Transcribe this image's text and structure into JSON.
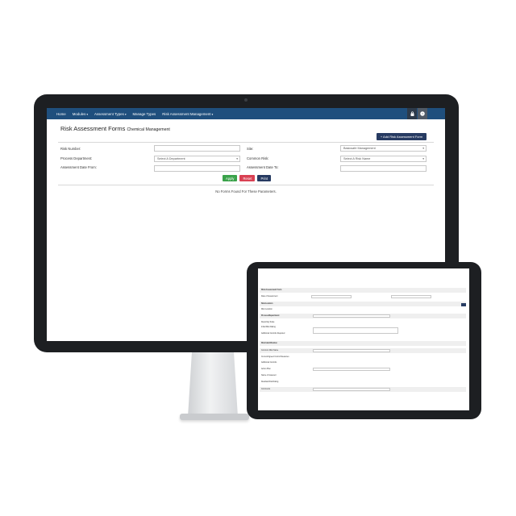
{
  "nav": {
    "items": [
      {
        "label": "Home",
        "dropdown": false
      },
      {
        "label": "Modules",
        "dropdown": true
      },
      {
        "label": "Assessment Types",
        "dropdown": true
      },
      {
        "label": "Manage Types",
        "dropdown": false
      },
      {
        "label": "Risk Assessment Management",
        "dropdown": true
      }
    ],
    "caret": "▾",
    "lock_icon": "lock-icon",
    "help_icon": "help-icon"
  },
  "page": {
    "title": "Risk Assessment Forms",
    "subtitle": "Chemical Management",
    "add_button": "+ Add Risk Assessment Form"
  },
  "filters": {
    "risk_number_label": "Risk Number:",
    "site_label": "Site:",
    "site_value": "Basicsafe Management",
    "process_department_label": "Process Department:",
    "department_placeholder": "Select A Department",
    "common_risk_label": "Common Risk:",
    "risk_name_placeholder": "Select A Risk Name",
    "date_from_label": "Assessment Date From:",
    "date_to_label": "Assessment Date To:"
  },
  "actions": {
    "apply": "Apply",
    "reset": "Reset",
    "print": "Print"
  },
  "results": {
    "message": "No Forms Found For These Parameters."
  },
  "tablet": {
    "rows": [
      "Risk Assessment Form",
      "Date of Assessment",
      "Site/Location",
      "Risk Location",
      "Process/Department",
      "Reporting Scale",
      "Initial Risk Rating",
      "Additional Controls Required",
      "Risk Identification",
      "Common Risk Name",
      "Current/Agreed Control Measures",
      "Additional Controls",
      "Action Plan",
      "Name of Assessor",
      "Residual Risk Rating",
      "Comments"
    ]
  }
}
